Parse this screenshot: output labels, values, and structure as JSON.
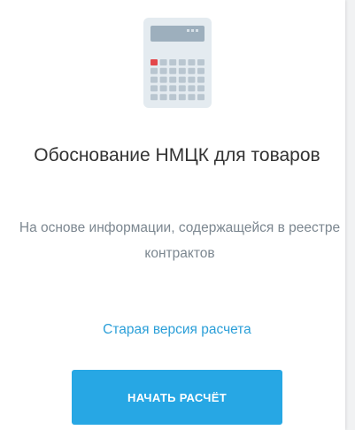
{
  "card": {
    "icon": "calculator-icon",
    "title": "Обоснование НМЦК для товаров",
    "description": "На основе информации, содержащейся в реестре контрактов",
    "old_version_link": "Старая версия расчета",
    "start_button": "НАЧАТЬ РАСЧЁТ"
  },
  "colors": {
    "accent": "#27a7e4",
    "link": "#2b9fd8",
    "title_text": "#333333",
    "muted_text": "#7c8790",
    "calc_key_red": "#e3474b"
  }
}
